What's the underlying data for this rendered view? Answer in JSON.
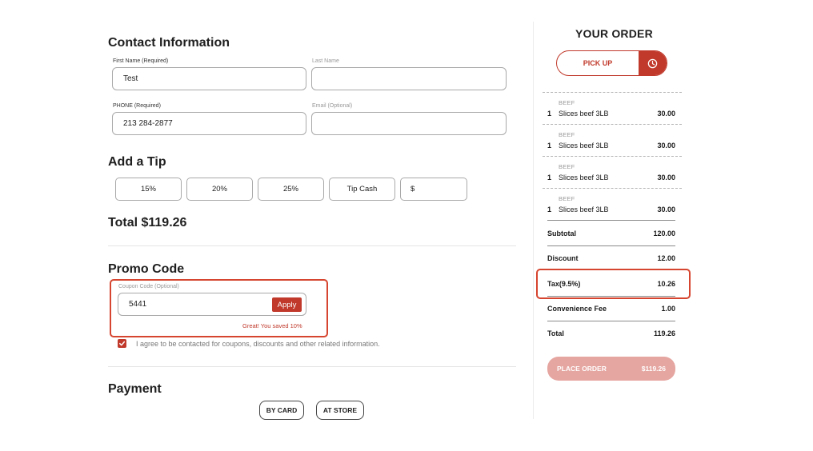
{
  "contact": {
    "title": "Contact Information",
    "first_name_label": "First Name (Required)",
    "first_name_value": "Test",
    "last_name_label": "Last Name",
    "last_name_value": "",
    "phone_label": "PHONE (Required)",
    "phone_value": "213 284-2877",
    "email_label": "Email (Optional)",
    "email_value": ""
  },
  "tip": {
    "title": "Add a Tip",
    "options": [
      "15%",
      "20%",
      "25%",
      "Tip Cash"
    ],
    "custom_prefix": "$"
  },
  "total_line": "Total $119.26",
  "promo": {
    "title": "Promo Code",
    "coupon_label": "Coupon Code (Optional)",
    "coupon_value": "5441",
    "apply_label": "Apply",
    "saved_message": "Great! You saved 10%"
  },
  "agree_text": "I agree to be contacted for coupons, discounts and other related information.",
  "agree_checked": true,
  "payment": {
    "title": "Payment",
    "options": [
      "BY CARD",
      "AT STORE"
    ]
  },
  "order": {
    "title": "YOUR ORDER",
    "mode_label": "PICK UP",
    "items": [
      {
        "category": "BEEF",
        "qty": "1",
        "name": "Slices beef 3LB",
        "price": "30.00"
      },
      {
        "category": "BEEF",
        "qty": "1",
        "name": "Slices beef 3LB",
        "price": "30.00"
      },
      {
        "category": "BEEF",
        "qty": "1",
        "name": "Slices beef 3LB",
        "price": "30.00"
      },
      {
        "category": "BEEF",
        "qty": "1",
        "name": "Slices beef 3LB",
        "price": "30.00"
      }
    ],
    "summary": {
      "subtotal_label": "Subtotal",
      "subtotal": "120.00",
      "discount_label": "Discount",
      "discount": "12.00",
      "tax_label": "Tax(9.5%)",
      "tax": "10.26",
      "fee_label": "Convenience Fee",
      "fee": "1.00",
      "total_label": "Total",
      "total": "119.26"
    },
    "place_order_label": "PLACE ORDER",
    "place_order_amount": "$119.26"
  },
  "colors": {
    "accent": "#c0392b",
    "highlight_border": "#d6452f",
    "place_order_disabled": "#e5a5a0"
  },
  "icons": {
    "pickup": "clock-icon",
    "agree": "check-icon"
  }
}
